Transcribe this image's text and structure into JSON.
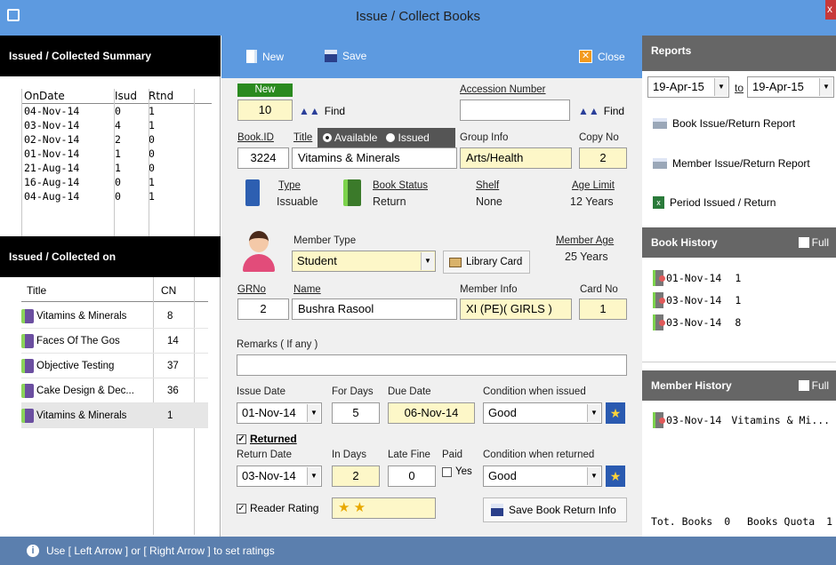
{
  "window": {
    "title": "Issue / Collect Books",
    "close_glyph": "x"
  },
  "left": {
    "summary_title": "Issued / Collected Summary",
    "summary_headers": [
      "OnDate",
      "Isud",
      "Rtnd"
    ],
    "summary_rows": [
      [
        "04-Nov-14",
        "0",
        "1"
      ],
      [
        "03-Nov-14",
        "4",
        "1"
      ],
      [
        "02-Nov-14",
        "2",
        "0"
      ],
      [
        "01-Nov-14",
        "1",
        "0"
      ],
      [
        "21-Aug-14",
        "1",
        "0"
      ],
      [
        "16-Aug-14",
        "0",
        "1"
      ],
      [
        "04-Aug-14",
        "0",
        "1"
      ]
    ],
    "collected_title": "Issued / Collected on",
    "collected_headers": [
      "Title",
      "CN"
    ],
    "collected_rows": [
      [
        "Vitamins & Minerals",
        "8"
      ],
      [
        "Faces Of The Gos",
        "14"
      ],
      [
        "Objective Testing",
        "37"
      ],
      [
        "Cake Design & Dec...",
        "36"
      ],
      [
        "Vitamins & Minerals",
        "1"
      ]
    ]
  },
  "toolbar": {
    "new_label": "New",
    "save_label": "Save",
    "close_label": "Close"
  },
  "form": {
    "new_badge": "New",
    "issue_no": "10",
    "find_label": "Find",
    "accession_label": "Accession Number",
    "accession_value": "",
    "find2_label": "Find",
    "bookid_label": "Book.ID",
    "bookid_value": "3224",
    "title_label": "Title",
    "radio_available": "Available",
    "radio_issued": "Issued",
    "title_value": "Vitamins & Minerals",
    "group_label": "Group Info",
    "group_value": "Arts/Health",
    "copy_label": "Copy No",
    "copy_value": "2",
    "type_label": "Type",
    "type_value": "Issuable",
    "status_label": "Book Status",
    "status_value": "Return",
    "shelf_label": "Shelf",
    "shelf_value": "None",
    "age_label": "Age Limit",
    "age_value": "12 Years",
    "member_type_label": "Member Type",
    "member_type_value": "Student",
    "library_card_label": "Library Card",
    "member_age_label": "Member Age",
    "member_age_value": "25 Years",
    "grno_label": "GRNo",
    "grno_value": "2",
    "name_label": "Name",
    "name_value": "Bushra Rasool",
    "member_info_label": "Member Info",
    "member_info_value": "XI (PE)( GIRLS )",
    "card_label": "Card No",
    "card_value": "1",
    "remarks_label": "Remarks ( If any )",
    "remarks_value": "",
    "issue_date_label": "Issue Date",
    "issue_date_value": "01-Nov-14",
    "for_days_label": "For Days",
    "for_days_value": "5",
    "due_label": "Due Date",
    "due_value": "06-Nov-14",
    "cond_issued_label": "Condition when issued",
    "cond_issued_value": "Good",
    "returned_label": "Returned",
    "return_date_label": "Return Date",
    "return_date_value": "03-Nov-14",
    "in_days_label": "In Days",
    "in_days_value": "2",
    "late_fine_label": "Late Fine",
    "late_fine_value": "0",
    "paid_label": "Paid",
    "paid_yes": "Yes",
    "cond_returned_label": "Condition when returned",
    "cond_returned_value": "Good",
    "reader_rating_label": "Reader Rating",
    "rating_stars": 2,
    "rating_glyphs": "★ ★",
    "save_return_label": "Save Book Return Info"
  },
  "right": {
    "reports_title": "Reports",
    "date_from": "19-Apr-15",
    "to_label": "to",
    "date_to": "19-Apr-15",
    "report_buttons": [
      "Book Issue/Return Report",
      "Member Issue/Return Report",
      "Period Issued / Return"
    ],
    "book_history_title": "Book History",
    "full_label": "Full",
    "book_history_rows": [
      [
        "01-Nov-14",
        "1"
      ],
      [
        "03-Nov-14",
        "1"
      ],
      [
        "03-Nov-14",
        "8"
      ]
    ],
    "member_history_title": "Member History",
    "member_history_rows": [
      [
        "03-Nov-14",
        "Vitamins & Mi..."
      ]
    ],
    "tot_books_label": "Tot. Books",
    "tot_books_value": "0",
    "quota_label": "Books Quota",
    "quota_value": "1"
  },
  "status": {
    "hint": "Use [ Left Arrow ] or [ Right Arrow ] to set ratings"
  },
  "colors": {
    "titlebar": "#5d9ae0",
    "toolbar": "#5d9ae0",
    "highlight_field": "#fdf7c8",
    "new_badge": "#2a8a1f",
    "statusbar": "#5b7fae"
  }
}
